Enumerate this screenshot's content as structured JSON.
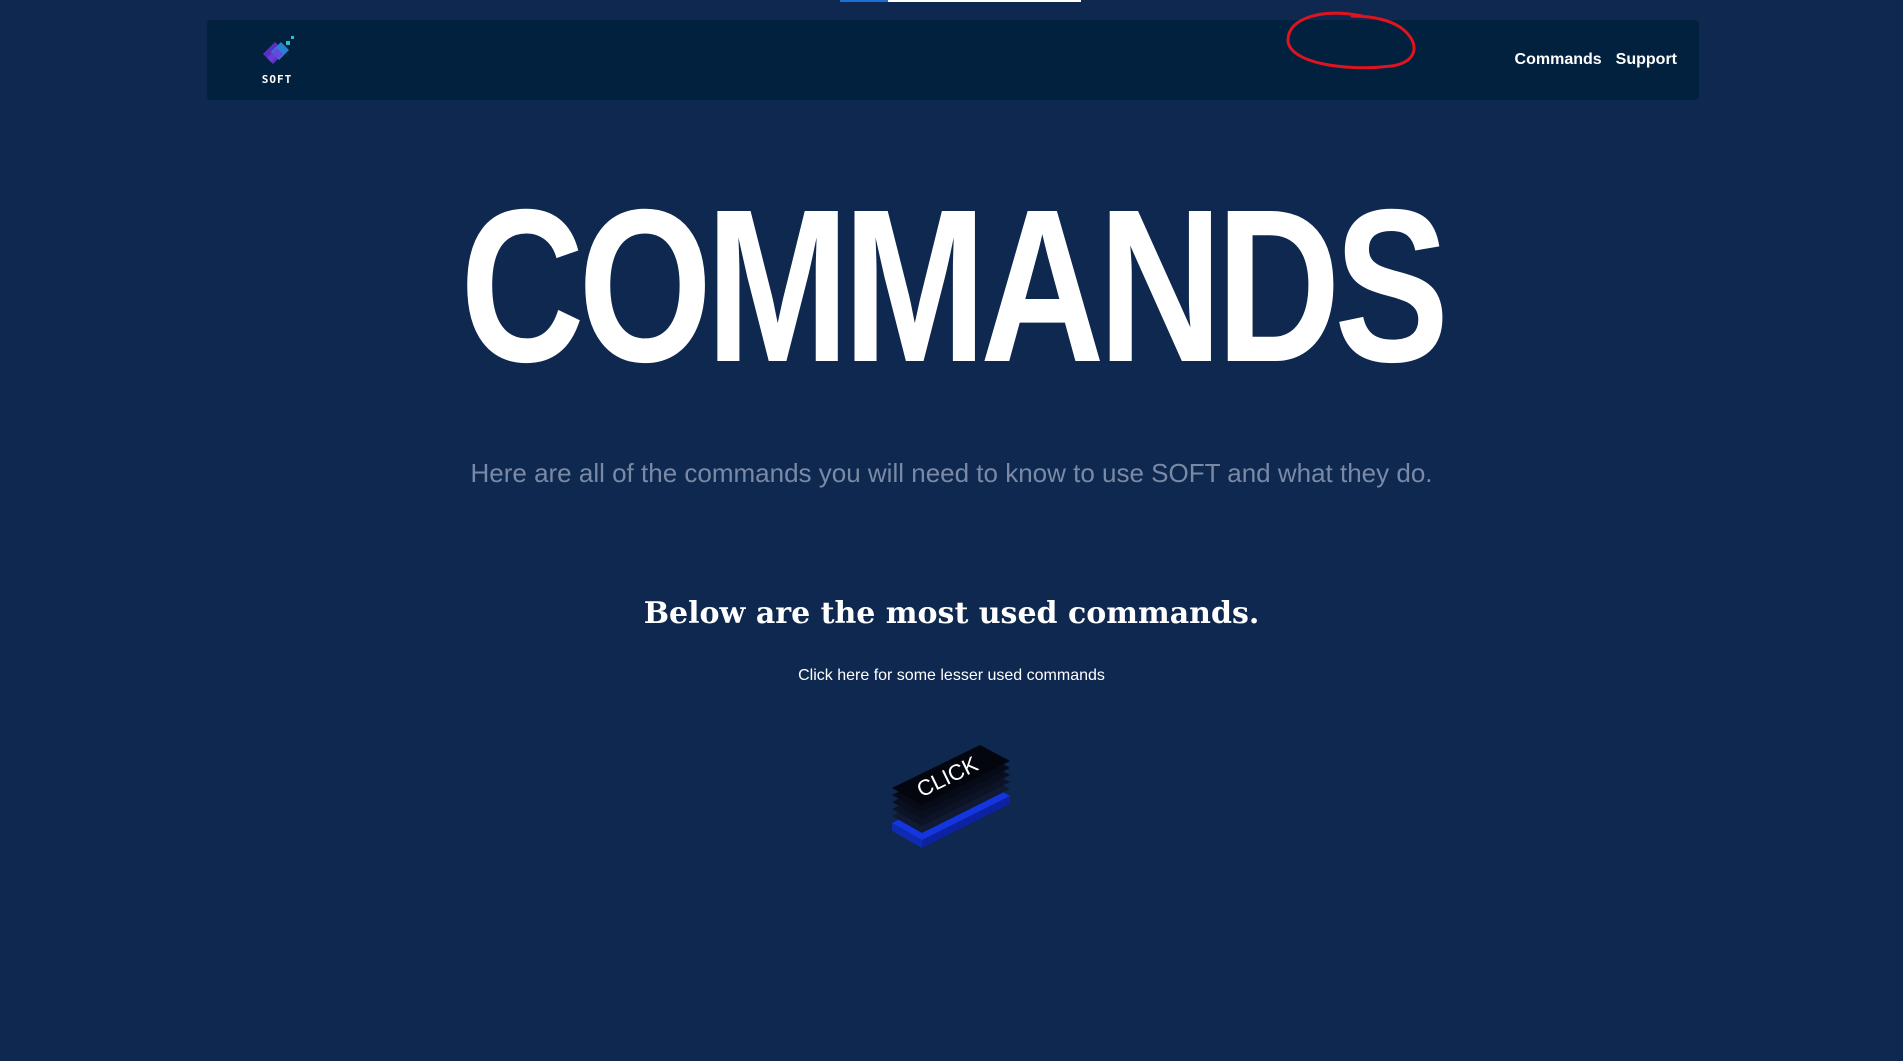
{
  "navbar": {
    "logo_text": "SOFT",
    "links": [
      {
        "label": "Commands"
      },
      {
        "label": "Support"
      }
    ]
  },
  "hero": {
    "title": "COMMANDS",
    "subtitle": "Here are all of the commands you will need to know to use SOFT and what they do."
  },
  "section": {
    "heading": "Below are the most used commands.",
    "link_text": "Click here for some lesser used commands"
  },
  "click_button": {
    "label": "CLICK"
  },
  "colors": {
    "background": "#0e2850",
    "navbar": "#02213f",
    "annotation": "#e0141e",
    "button_accent": "#1436e0"
  }
}
